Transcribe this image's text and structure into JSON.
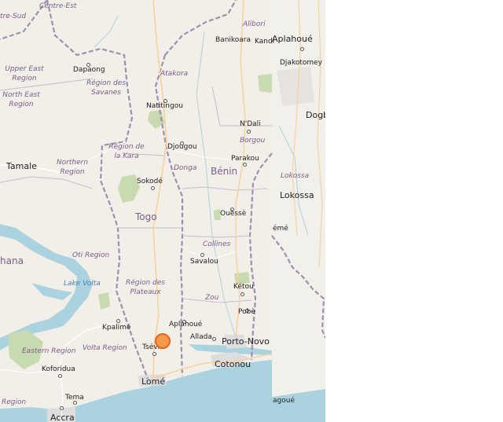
{
  "map": {
    "places": [
      {
        "name": "Centre-Est",
        "kind": "region"
      },
      {
        "name": "tre-Sud",
        "kind": "region"
      },
      {
        "name": "Alibori",
        "kind": "region"
      },
      {
        "name": "Banikoara",
        "kind": "city"
      },
      {
        "name": "Kandi",
        "kind": "city"
      },
      {
        "name": "Aplahoué",
        "kind": "city-lg"
      },
      {
        "name": "Djakotomey",
        "kind": "city"
      },
      {
        "name": "Dapaong",
        "kind": "city"
      },
      {
        "name": "Upper East Region",
        "kind": "region"
      },
      {
        "name": "Région des Savanes",
        "kind": "region"
      },
      {
        "name": "Atakora",
        "kind": "region"
      },
      {
        "name": "North East Region",
        "kind": "region"
      },
      {
        "name": "Natitingou",
        "kind": "city"
      },
      {
        "name": "Dogb",
        "kind": "city-lg"
      },
      {
        "name": "N'Dali",
        "kind": "city"
      },
      {
        "name": "Borgou",
        "kind": "region"
      },
      {
        "name": "Région de la Kara",
        "kind": "region"
      },
      {
        "name": "Djougou",
        "kind": "city"
      },
      {
        "name": "Parakou",
        "kind": "city"
      },
      {
        "name": "Tamale",
        "kind": "city-lg"
      },
      {
        "name": "Northern Region",
        "kind": "region"
      },
      {
        "name": "Donga",
        "kind": "region"
      },
      {
        "name": "Bénin",
        "kind": "country"
      },
      {
        "name": "Lokossa",
        "kind": "region"
      },
      {
        "name": "Lokossa",
        "kind": "city-lg"
      },
      {
        "name": "Sokodé",
        "kind": "city"
      },
      {
        "name": "Togo",
        "kind": "country"
      },
      {
        "name": "Ouèssè",
        "kind": "city"
      },
      {
        "name": "émé",
        "kind": "city"
      },
      {
        "name": "Collines",
        "kind": "region"
      },
      {
        "name": "Oti Region",
        "kind": "region"
      },
      {
        "name": "hana",
        "kind": "country"
      },
      {
        "name": "Savalou",
        "kind": "city"
      },
      {
        "name": "Lake Volta",
        "kind": "water"
      },
      {
        "name": "Région des Plateaux",
        "kind": "region"
      },
      {
        "name": "Kétou",
        "kind": "city"
      },
      {
        "name": "Zou",
        "kind": "region"
      },
      {
        "name": "Pobè",
        "kind": "city"
      },
      {
        "name": "Kpalimé",
        "kind": "city"
      },
      {
        "name": "Aplahoué",
        "kind": "city"
      },
      {
        "name": "Allada",
        "kind": "city"
      },
      {
        "name": "Porto-Novo",
        "kind": "city-lg"
      },
      {
        "name": "Tsévié",
        "kind": "city"
      },
      {
        "name": "Eastern Region",
        "kind": "region"
      },
      {
        "name": "Volta Region",
        "kind": "region"
      },
      {
        "name": "Cotonou",
        "kind": "city-lg"
      },
      {
        "name": "Koforidua",
        "kind": "city"
      },
      {
        "name": "Lomé",
        "kind": "city-lg"
      },
      {
        "name": "Tema",
        "kind": "city"
      },
      {
        "name": "Region",
        "kind": "region"
      },
      {
        "name": "Accra",
        "kind": "city-lg"
      },
      {
        "name": "agoué",
        "kind": "city"
      }
    ],
    "marker": {
      "color": "#f39b4a",
      "outline": "#e8641c"
    }
  }
}
